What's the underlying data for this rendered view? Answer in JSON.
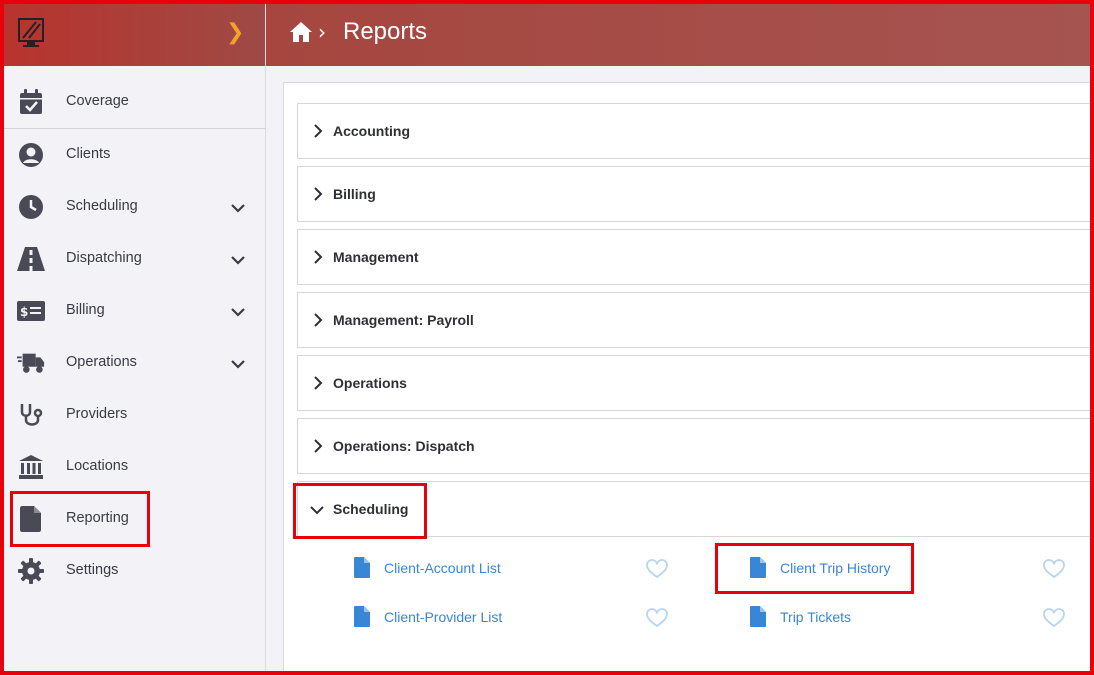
{
  "breadcrumb": {
    "title": "Reports"
  },
  "sidebar": {
    "items": [
      {
        "label": "Coverage",
        "icon": "calendar-check-icon"
      },
      {
        "label": "Clients",
        "icon": "user-circle-icon"
      },
      {
        "label": "Scheduling",
        "icon": "clock-icon"
      },
      {
        "label": "Dispatching",
        "icon": "road-icon"
      },
      {
        "label": "Billing",
        "icon": "money-bill-icon"
      },
      {
        "label": "Operations",
        "icon": "truck-icon"
      },
      {
        "label": "Providers",
        "icon": "stethoscope-icon"
      },
      {
        "label": "Locations",
        "icon": "landmark-icon"
      },
      {
        "label": "Reporting",
        "icon": "file-icon"
      },
      {
        "label": "Settings",
        "icon": "gear-icon"
      }
    ]
  },
  "sections": [
    {
      "title": "Accounting"
    },
    {
      "title": "Billing"
    },
    {
      "title": "Management"
    },
    {
      "title": "Management: Payroll"
    },
    {
      "title": "Operations"
    },
    {
      "title": "Operations: Dispatch"
    },
    {
      "title": "Scheduling"
    }
  ],
  "scheduling_reports": [
    {
      "label": "Client-Account List"
    },
    {
      "label": "Client Trip History"
    },
    {
      "label": "Client-Provider List"
    },
    {
      "label": "Trip Tickets"
    }
  ],
  "colors": {
    "header": "#a6463f",
    "accent_orange": "#f3a12a",
    "link_blue": "#3a86d6",
    "highlight_red": "#e8000b",
    "sidebar_bg": "#f2f2f7"
  }
}
